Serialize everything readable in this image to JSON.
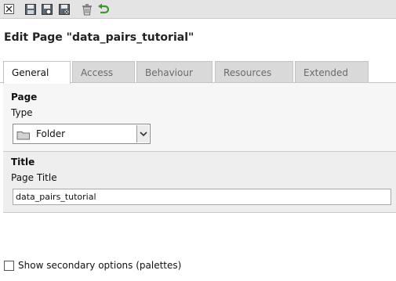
{
  "toolbar": {
    "icons": [
      "close-icon",
      "save-icon",
      "save-and-view-icon",
      "save-and-close-icon",
      "delete-icon",
      "undo-icon"
    ]
  },
  "heading": "Edit Page \"data_pairs_tutorial\"",
  "tabs": [
    {
      "label": "General",
      "active": true
    },
    {
      "label": "Access",
      "active": false
    },
    {
      "label": "Behaviour",
      "active": false
    },
    {
      "label": "Resources",
      "active": false
    },
    {
      "label": "Extended",
      "active": false
    }
  ],
  "page_section": {
    "title": "Page",
    "type_label": "Type",
    "type_value": "Folder"
  },
  "title_section": {
    "title": "Title",
    "page_title_label": "Page Title",
    "page_title_value": "data_pairs_tutorial"
  },
  "palette_option": {
    "label": "Show secondary options (palettes)",
    "checked": false
  },
  "colors": {
    "toolbar_bg": "#e4e4e4",
    "tab_inactive": "#d9d9d9",
    "section_bg": "#f6f6f6",
    "undo_green": "#3a9a2a"
  }
}
